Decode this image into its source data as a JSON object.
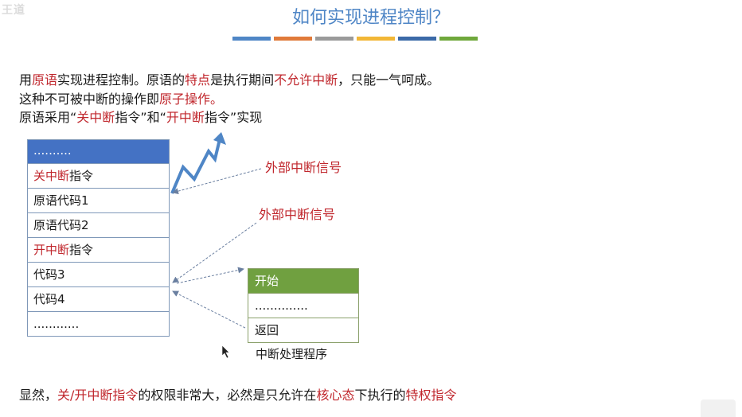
{
  "watermark": {
    "text": "王道"
  },
  "title": "如何实现进程控制？",
  "colors": [
    "#4f86c6",
    "#e07a3a",
    "#9a9a9a",
    "#f2b736",
    "#3c6aa8",
    "#6fa83c"
  ],
  "para": {
    "line1": [
      {
        "t": "用",
        "r": false
      },
      {
        "t": "原语",
        "r": true
      },
      {
        "t": "实现进程控制。原语的",
        "r": false
      },
      {
        "t": "特点",
        "r": true
      },
      {
        "t": "是执行期间",
        "r": false
      },
      {
        "t": "不允许中断",
        "r": true
      },
      {
        "t": "，只能一气呵成。",
        "r": false
      }
    ],
    "line2": [
      {
        "t": "这种不可被中断的操作即",
        "r": false
      },
      {
        "t": "原子操作。",
        "r": true
      }
    ],
    "line3": [
      {
        "t": "原语采用“",
        "r": false
      },
      {
        "t": "关中断",
        "r": true
      },
      {
        "t": "指令”和“",
        "r": false
      },
      {
        "t": "开中断",
        "r": true
      },
      {
        "t": "指令”实现",
        "r": false
      }
    ]
  },
  "stack": [
    {
      "parts": [
        {
          "t": "..........",
          "r": false
        }
      ],
      "head": true
    },
    {
      "parts": [
        {
          "t": "关中断",
          "r": true
        },
        {
          "t": "指令",
          "r": false
        }
      ]
    },
    {
      "parts": [
        {
          "t": "原语代码1",
          "r": false
        }
      ]
    },
    {
      "parts": [
        {
          "t": "原语代码2",
          "r": false
        }
      ]
    },
    {
      "parts": [
        {
          "t": "开中断",
          "r": true
        },
        {
          "t": "指令",
          "r": false
        }
      ]
    },
    {
      "parts": [
        {
          "t": "代码3",
          "r": false
        }
      ]
    },
    {
      "parts": [
        {
          "t": "代码4",
          "r": false
        }
      ]
    },
    {
      "parts": [
        {
          "t": "............",
          "r": false
        }
      ]
    }
  ],
  "signals": {
    "s1": "外部中断信号",
    "s2": "外部中断信号"
  },
  "handler": {
    "rows": [
      "开始",
      "..............",
      "返回"
    ],
    "caption": "中断处理程序"
  },
  "bottom": [
    {
      "t": "显然，",
      "r": false
    },
    {
      "t": "关/开中断指令",
      "r": true
    },
    {
      "t": "的权限非常大，必然是只允许在",
      "r": false
    },
    {
      "t": "核心态",
      "r": true
    },
    {
      "t": "下执行的",
      "r": false
    },
    {
      "t": "特权指令",
      "r": true
    }
  ]
}
